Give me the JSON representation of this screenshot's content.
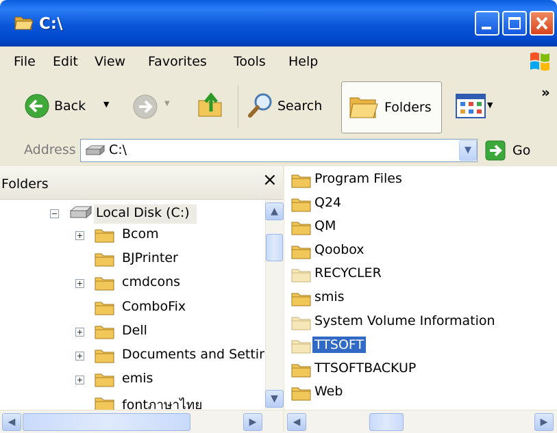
{
  "window": {
    "title": "C:\\"
  },
  "menu": [
    "File",
    "Edit",
    "View",
    "Favorites",
    "Tools",
    "Help"
  ],
  "toolbar": {
    "back": "Back",
    "search": "Search",
    "folders": "Folders",
    "chevron": "»"
  },
  "address": {
    "label": "Address",
    "value": "C:\\",
    "go": "Go"
  },
  "folders_pane": {
    "title": "Folders",
    "close": "×",
    "root": "Local Disk (C:)",
    "items": [
      "Bcom",
      "BJPrinter",
      "cmdcons",
      "ComboFix",
      "Dell",
      "Documents and Settir",
      "emis",
      "fontภาษาไทย"
    ]
  },
  "files": [
    "Program Files",
    "Q24",
    "QM",
    "Qoobox",
    "RECYCLER",
    "smis",
    "System Volume Information",
    "TTSOFT",
    "TTSOFTBACKUP",
    "Web"
  ],
  "selected_file": "TTSOFT",
  "colors": {
    "title_blue": "#0a56d8",
    "selection": "#316ac5",
    "folder": "#f2c75a"
  }
}
